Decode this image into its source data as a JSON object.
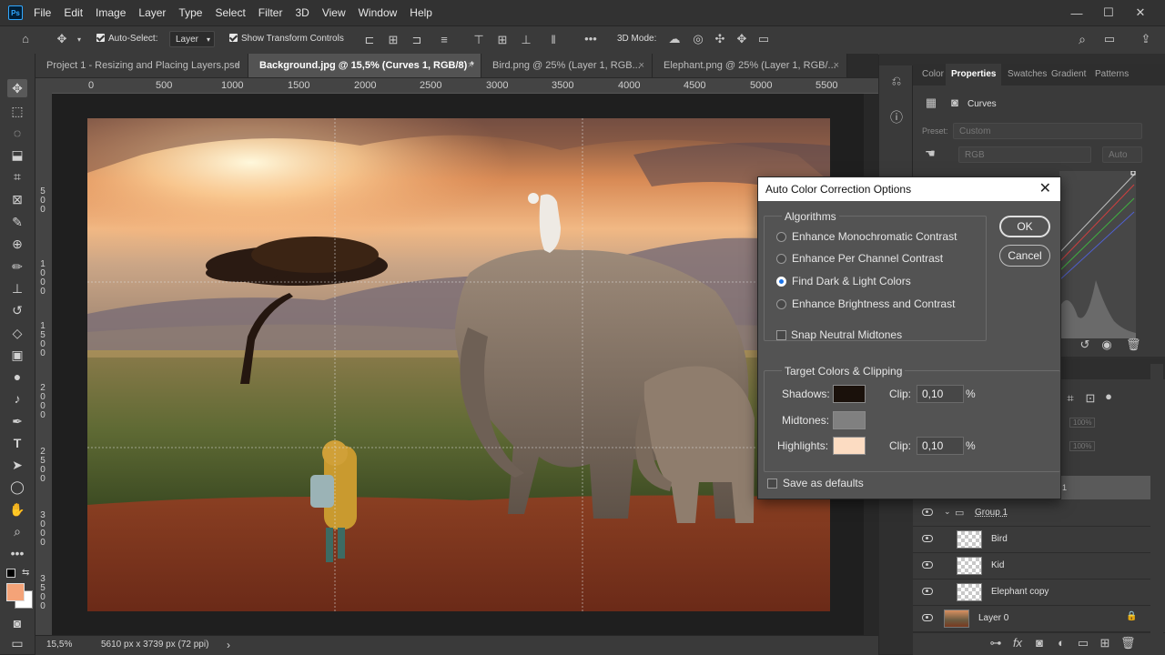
{
  "app": {
    "logo": "Ps"
  },
  "menu": [
    "File",
    "Edit",
    "Image",
    "Layer",
    "Type",
    "Select",
    "Filter",
    "3D",
    "View",
    "Window",
    "Help"
  ],
  "window_controls": {
    "minimize": "—",
    "maximize": "☐",
    "close": "✕"
  },
  "options_bar": {
    "auto_select_label": "Auto-Select:",
    "auto_select_target": "Layer",
    "show_transform_label": "Show Transform Controls",
    "mode_3d_label": "3D Mode:",
    "more": "•••"
  },
  "tabs": [
    {
      "label": "Project 1 - Resizing and Placing Layers.psd",
      "active": false
    },
    {
      "label": "Background.jpg @ 15,5% (Curves 1, RGB/8) *",
      "active": true
    },
    {
      "label": "Bird.png @ 25% (Layer 1, RGB...",
      "active": false
    },
    {
      "label": "Elephant.png @ 25% (Layer 1, RGB/...",
      "active": false
    }
  ],
  "tab_close": "×",
  "ruler": {
    "h": [
      "0",
      "500",
      "1000",
      "1500",
      "2000",
      "2500",
      "3000",
      "3500",
      "4000",
      "4500",
      "5000",
      "5500"
    ],
    "v": [
      "5\n0\n0",
      "1\n0\n0\n0",
      "1\n5\n0\n0",
      "2\n0\n0\n0",
      "2\n5\n0\n0",
      "3\n0\n0\n0",
      "3\n5\n0\n0"
    ]
  },
  "status": {
    "zoom": "15,5%",
    "doc_size": "5610 px x 3739 px (72 ppi)",
    "arrow": "›"
  },
  "properties": {
    "tabs": [
      "Color",
      "Properties",
      "Swatches",
      "Gradient",
      "Patterns"
    ],
    "active_tab": "Properties",
    "adjustment": "Curves",
    "preset_label": "Preset:",
    "preset_value": "Custom",
    "channel": "RGB",
    "auto_label": "Auto"
  },
  "layers": [
    {
      "name": "Group 1",
      "type": "group"
    },
    {
      "name": "Bird",
      "type": "layer"
    },
    {
      "name": "Kid",
      "type": "layer"
    },
    {
      "name": "Elephant copy",
      "type": "layer"
    },
    {
      "name": "Layer 0",
      "type": "background"
    }
  ],
  "layers_opacity": "100%",
  "layers_fill": "100%",
  "layer_partial_label": "1",
  "dialog": {
    "title": "Auto Color Correction Options",
    "close": "✕",
    "algorithms_title": "Algorithms",
    "algorithms": [
      {
        "label": "Enhance Monochromatic Contrast",
        "selected": false
      },
      {
        "label": "Enhance Per Channel Contrast",
        "selected": false
      },
      {
        "label": "Find Dark & Light Colors",
        "selected": true
      },
      {
        "label": "Enhance Brightness and Contrast",
        "selected": false
      }
    ],
    "snap_label": "Snap Neutral Midtones",
    "target_title": "Target Colors & Clipping",
    "shadows_label": "Shadows:",
    "midtones_label": "Midtones:",
    "highlights_label": "Highlights:",
    "clip_label": "Clip:",
    "shadows_clip": "0,10",
    "highlights_clip": "0,10",
    "percent": "%",
    "shadows_color": "#1a110b",
    "midtones_color": "#808080",
    "highlights_color": "#fcdcc2",
    "save_defaults": "Save as defaults",
    "ok": "OK",
    "cancel": "Cancel"
  },
  "colors": {
    "foreground": "#f4a378",
    "background": "#ffffff"
  }
}
